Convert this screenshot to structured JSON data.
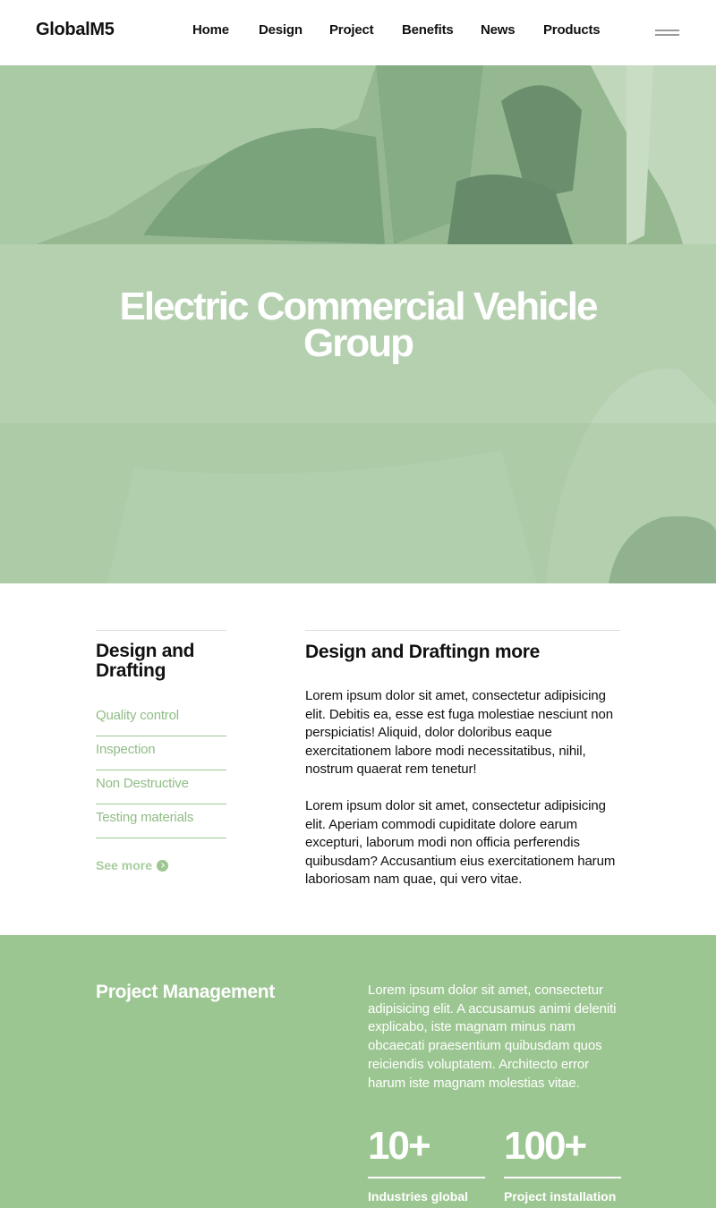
{
  "header": {
    "logo": "GlobalM5",
    "nav": [
      "Home",
      "Design",
      "Project",
      "Benefits",
      "News",
      "Products"
    ],
    "menu_icon": "hamburger-menu-icon"
  },
  "hero": {
    "title": "Electric Commercial Vehicle Group",
    "overlay_color": "#b3cfae"
  },
  "design": {
    "sidebar_title": "Design and Drafting",
    "sidebar_items": [
      "Quality control",
      "Inspection",
      "Non Destructive",
      "Testing materials"
    ],
    "see_more": "See more",
    "main_title": "Design and Draftingn more",
    "paragraphs": [
      "Lorem ipsum dolor sit amet, consectetur adipisicing elit. Debitis ea, esse est fuga molestiae nesciunt non perspiciatis! Aliquid, dolor doloribus eaque exercitationem labore modi necessitatibus, nihil, nostrum quaerat rem tenetur!",
      "Lorem ipsum dolor sit amet, consectetur adipisicing elit. Aperiam commodi cupiditate dolore earum excepturi, laborum modi non officia perferendis quibusdam? Accusantium eius exercitationem harum laboriosam nam quae, qui vero vitae."
    ],
    "accent_color": "#9cc791"
  },
  "project_management": {
    "title": "Project Management",
    "text": "Lorem ipsum dolor sit amet, consectetur adipisicing elit. A accusamus animi deleniti explicabo, iste magnam minus nam obcaecati praesentium quibusdam quos reiciendis voluptatem. Architecto error harum iste magnam molestias vitae.",
    "stats": [
      {
        "value": "10+",
        "label": "Industries global"
      },
      {
        "value": "100+",
        "label": "Project installation"
      }
    ],
    "background_color": "#9cc691"
  }
}
